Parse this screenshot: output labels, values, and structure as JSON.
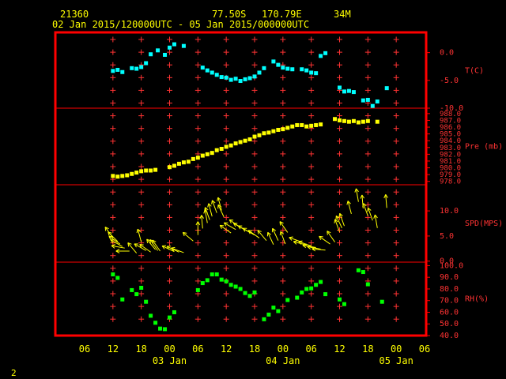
{
  "header": {
    "station_id": "21360",
    "latitude": "77.50S",
    "longitude": "170.79E",
    "elevation": "34M",
    "period": "02 Jan 2015/120000UTC - 05 Jan 2015/000000UTC"
  },
  "page_number": "2",
  "colors": {
    "frame": "#ff0000",
    "tick": "#ff3333",
    "label": "#ff3333",
    "axis_text": "#ffff00",
    "temperature": "#00ffff",
    "pressure": "#ffff00",
    "wind": "#ffff00",
    "humidity": "#00ff00"
  },
  "chart_data": {
    "type": "scatter",
    "x_axis": {
      "unit": "hours since first tick",
      "xlim": [
        0,
        72
      ],
      "tick_labels": [
        "06",
        "12",
        "18",
        "00",
        "06",
        "12",
        "18",
        "00",
        "06",
        "12",
        "18",
        "00",
        "06"
      ],
      "tick_hours": [
        0,
        6,
        12,
        18,
        24,
        30,
        36,
        42,
        48,
        54,
        60,
        66,
        72
      ],
      "day_labels": [
        {
          "label": "03 Jan",
          "hour": 18
        },
        {
          "label": "04 Jan",
          "hour": 42
        },
        {
          "label": "05 Jan",
          "hour": 66
        }
      ]
    },
    "panels": [
      {
        "id": "temperature",
        "label": "T(C)",
        "ylim": [
          -10,
          3.5
        ],
        "ticks": [
          -10,
          -5,
          0
        ],
        "tick_labels": [
          "-10.0",
          "-5.0",
          "0.0"
        ],
        "marker": "square",
        "points": [
          [
            6,
            -3.3
          ],
          [
            7,
            -3.1
          ],
          [
            8,
            -3.5
          ],
          [
            10,
            -2.8
          ],
          [
            11,
            -2.9
          ],
          [
            12,
            -2.6
          ],
          [
            13,
            -1.9
          ],
          [
            14,
            -0.3
          ],
          [
            15.5,
            0.4
          ],
          [
            17,
            -0.4
          ],
          [
            18,
            0.9
          ],
          [
            19,
            1.5
          ],
          [
            21,
            1.2
          ],
          [
            25,
            -2.7
          ],
          [
            26,
            -3.2
          ],
          [
            27,
            -3.6
          ],
          [
            28,
            -4.0
          ],
          [
            29,
            -4.4
          ],
          [
            30,
            -4.5
          ],
          [
            31,
            -4.9
          ],
          [
            32,
            -4.7
          ],
          [
            33,
            -5.1
          ],
          [
            34,
            -4.8
          ],
          [
            35,
            -4.6
          ],
          [
            36,
            -4.3
          ],
          [
            37,
            -3.6
          ],
          [
            38,
            -2.8
          ],
          [
            40,
            -1.6
          ],
          [
            41,
            -2.2
          ],
          [
            42,
            -2.7
          ],
          [
            43,
            -2.9
          ],
          [
            44,
            -3.0
          ],
          [
            46,
            -3.0
          ],
          [
            47,
            -3.2
          ],
          [
            48,
            -3.6
          ],
          [
            49,
            -3.7
          ],
          [
            50,
            -0.6
          ],
          [
            51,
            -0.1
          ],
          [
            54,
            -6.3
          ],
          [
            55,
            -7.0
          ],
          [
            56,
            -6.9
          ],
          [
            57,
            -7.1
          ],
          [
            59,
            -8.6
          ],
          [
            60,
            -8.5
          ],
          [
            61,
            -9.6
          ],
          [
            62,
            -8.8
          ],
          [
            64,
            -6.4
          ]
        ]
      },
      {
        "id": "pressure",
        "label": "Pre (mb)",
        "ylim": [
          977.5,
          988.8
        ],
        "ticks": [
          978,
          979,
          980,
          981,
          982,
          983,
          984,
          985,
          986,
          987,
          988
        ],
        "tick_labels": [
          "978.0",
          "979.0",
          "980.0",
          "981.0",
          "982.0",
          "983.0",
          "984.0",
          "985.0",
          "986.0",
          "987.0",
          "988.0"
        ],
        "marker": "square",
        "points": [
          [
            6,
            978.8
          ],
          [
            7,
            978.7
          ],
          [
            8,
            978.8
          ],
          [
            9,
            978.9
          ],
          [
            10,
            979.1
          ],
          [
            11,
            979.3
          ],
          [
            12,
            979.5
          ],
          [
            13,
            979.6
          ],
          [
            14,
            979.6
          ],
          [
            15,
            979.7
          ],
          [
            18,
            980.1
          ],
          [
            19,
            980.3
          ],
          [
            20,
            980.6
          ],
          [
            21,
            980.8
          ],
          [
            22,
            980.9
          ],
          [
            23,
            981.3
          ],
          [
            24,
            981.5
          ],
          [
            25,
            981.8
          ],
          [
            26,
            982.0
          ],
          [
            27,
            982.2
          ],
          [
            28,
            982.6
          ],
          [
            29,
            982.8
          ],
          [
            30,
            983.1
          ],
          [
            31,
            983.3
          ],
          [
            32,
            983.6
          ],
          [
            33,
            983.8
          ],
          [
            34,
            984.0
          ],
          [
            35,
            984.2
          ],
          [
            36,
            984.6
          ],
          [
            37,
            984.8
          ],
          [
            38,
            985.1
          ],
          [
            39,
            985.2
          ],
          [
            40,
            985.4
          ],
          [
            41,
            985.6
          ],
          [
            42,
            985.7
          ],
          [
            43,
            985.9
          ],
          [
            44,
            986.1
          ],
          [
            45,
            986.3
          ],
          [
            46,
            986.3
          ],
          [
            47,
            986.1
          ],
          [
            48,
            986.2
          ],
          [
            49,
            986.3
          ],
          [
            50,
            986.4
          ],
          [
            53,
            987.2
          ],
          [
            54,
            987.0
          ],
          [
            55,
            986.9
          ],
          [
            56,
            986.8
          ],
          [
            57,
            986.9
          ],
          [
            58,
            986.7
          ],
          [
            59,
            986.8
          ],
          [
            60,
            986.9
          ],
          [
            62,
            986.8
          ]
        ]
      },
      {
        "id": "wind",
        "label": "SPD(MPS)",
        "ylim": [
          -0.2,
          15.2
        ],
        "ticks": [
          0,
          5,
          10
        ],
        "tick_labels": [
          "0.0",
          "5.0",
          "10.0"
        ],
        "marker": "arrow",
        "points": [
          [
            6,
            4.6,
            -35
          ],
          [
            7,
            3.9,
            -45
          ],
          [
            7.5,
            3.4,
            -55
          ],
          [
            8,
            2.9,
            -60
          ],
          [
            8.5,
            2.6,
            -80
          ],
          [
            9.5,
            2.0,
            -90
          ],
          [
            11,
            1.6,
            -40
          ],
          [
            12,
            3.8,
            -15
          ],
          [
            13,
            2.1,
            -60
          ],
          [
            14,
            1.8,
            -55
          ],
          [
            15,
            2.3,
            -40
          ],
          [
            15.5,
            2.1,
            -35
          ],
          [
            16,
            2.0,
            -35
          ],
          [
            19,
            1.9,
            -65
          ],
          [
            20,
            1.8,
            -65
          ],
          [
            21,
            1.7,
            -70
          ],
          [
            23,
            4.0,
            -50
          ],
          [
            24,
            5.2,
            0
          ],
          [
            25,
            6.5,
            -5
          ],
          [
            26,
            7.6,
            -10
          ],
          [
            26.5,
            8.2,
            -20
          ],
          [
            27,
            8.9,
            -15
          ],
          [
            28,
            9.6,
            -20
          ],
          [
            29,
            10.1,
            -15
          ],
          [
            29.5,
            8.8,
            -25
          ],
          [
            31,
            5.6,
            -55
          ],
          [
            32,
            6.3,
            -60
          ],
          [
            33,
            6.7,
            -55
          ],
          [
            34,
            6.2,
            -60
          ],
          [
            35,
            5.7,
            -60
          ],
          [
            36,
            5.2,
            -60
          ],
          [
            37,
            4.6,
            -55
          ],
          [
            38.5,
            4.1,
            -40
          ],
          [
            40,
            3.3,
            -25
          ],
          [
            41,
            4.1,
            -25
          ],
          [
            42.5,
            3.4,
            -20
          ],
          [
            43,
            5.7,
            -35
          ],
          [
            46,
            3.8,
            -70
          ],
          [
            47,
            3.2,
            -75
          ],
          [
            48,
            3.0,
            -70
          ],
          [
            49,
            2.7,
            -80
          ],
          [
            50,
            2.4,
            -80
          ],
          [
            51,
            2.2,
            -85
          ],
          [
            52,
            3.4,
            -55
          ],
          [
            53,
            3.8,
            -35
          ],
          [
            54,
            5.8,
            -20
          ],
          [
            54.5,
            6.6,
            -25
          ],
          [
            55,
            7.0,
            -20
          ],
          [
            56.5,
            9.4,
            -15
          ],
          [
            58,
            11.8,
            -10
          ],
          [
            59,
            10.5,
            -5
          ],
          [
            60,
            9.0,
            -20
          ],
          [
            61,
            8.1,
            -20
          ],
          [
            62,
            6.6,
            -10
          ],
          [
            64,
            10.6,
            -5
          ]
        ]
      },
      {
        "id": "humidity",
        "label": "RH(%)",
        "ylim": [
          40,
          103
        ],
        "ticks": [
          40,
          50,
          60,
          70,
          80,
          90,
          100
        ],
        "tick_labels": [
          "40.0",
          "50.0",
          "60.0",
          "70.0",
          "80.0",
          "90.0",
          "100.0"
        ],
        "marker": "square",
        "points": [
          [
            6,
            92.5
          ],
          [
            7,
            89.5
          ],
          [
            8,
            71
          ],
          [
            10,
            79
          ],
          [
            11,
            75.5
          ],
          [
            12,
            81
          ],
          [
            13,
            69
          ],
          [
            14,
            57
          ],
          [
            15,
            51
          ],
          [
            16,
            46
          ],
          [
            17,
            45.5
          ],
          [
            18,
            55.5
          ],
          [
            19,
            60
          ],
          [
            24,
            79
          ],
          [
            25,
            85
          ],
          [
            26,
            87.5
          ],
          [
            27,
            92.5
          ],
          [
            28,
            92.5
          ],
          [
            29,
            88
          ],
          [
            30,
            86.5
          ],
          [
            31,
            83.5
          ],
          [
            32,
            82
          ],
          [
            33,
            80
          ],
          [
            34,
            76.5
          ],
          [
            35,
            74
          ],
          [
            36,
            77
          ],
          [
            38,
            54
          ],
          [
            39,
            58
          ],
          [
            40,
            64
          ],
          [
            41,
            61
          ],
          [
            43,
            70.5
          ],
          [
            45,
            72.5
          ],
          [
            46,
            77
          ],
          [
            47,
            80
          ],
          [
            48,
            80.5
          ],
          [
            49,
            83.5
          ],
          [
            50,
            86
          ],
          [
            51,
            75.5
          ],
          [
            54,
            71
          ],
          [
            55,
            67
          ],
          [
            58,
            96
          ],
          [
            59,
            94.5
          ],
          [
            60,
            84
          ],
          [
            63,
            69
          ]
        ]
      }
    ]
  }
}
